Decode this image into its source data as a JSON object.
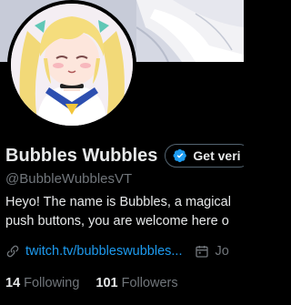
{
  "profile": {
    "display_name": "Bubbles Wubbles",
    "handle": "@BubbleWubblesVT",
    "verify_label": "Get veri",
    "bio_line1": "Heyo! The name is Bubbles, a magical",
    "bio_line2": "push buttons, you are welcome here o",
    "link_text": "twitch.tv/bubbleswubbles...",
    "joined_text": "Jo",
    "following_count": "14",
    "following_label": "Following",
    "followers_count": "101",
    "followers_label": "Followers"
  },
  "icons": {
    "verify": "verified-badge-icon",
    "link": "link-icon",
    "calendar": "calendar-icon"
  },
  "colors": {
    "background": "#000000",
    "text": "#e7e9ea",
    "muted": "#71767b",
    "accent": "#1d9bf0"
  }
}
